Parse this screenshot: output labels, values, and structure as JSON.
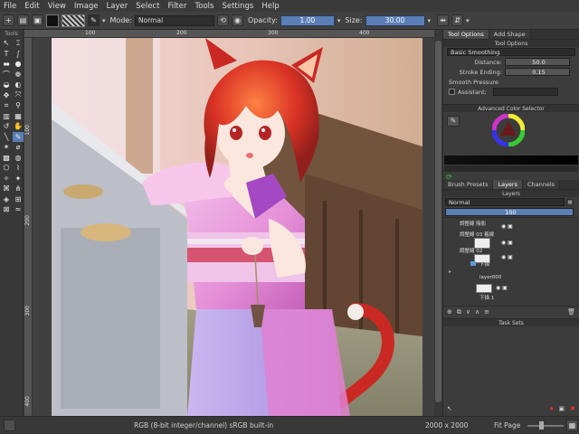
{
  "menu": [
    "File",
    "Edit",
    "View",
    "Image",
    "Layer",
    "Select",
    "Filter",
    "Tools",
    "Settings",
    "Help"
  ],
  "toolbar": {
    "mode_label": "Mode:",
    "mode_value": "Normal",
    "opacity_label": "Opacity:",
    "opacity_value": "1.00",
    "size_label": "Size:",
    "size_value": "30.00"
  },
  "toolbox_title": "Tools",
  "ruler": {
    "h_labels": [
      "100",
      "200",
      "300",
      "400"
    ],
    "v_labels": [
      "100",
      "200",
      "300",
      "400"
    ]
  },
  "dock": {
    "top_tabs": [
      "Tool Options",
      "Add Shape"
    ],
    "tool_options_title": "Tool Options",
    "smoothing": "Basic Smoothing",
    "distance_label": "Distance:",
    "distance_value": "50.0",
    "stroke_ending_label": "Stroke Ending:",
    "stroke_ending_value": "0.15",
    "smooth_pressure_label": "Smooth Pressure",
    "assistant_label": "Assistant:",
    "color_selector_title": "Advanced Color Selector",
    "mid_tabs": [
      "Brush Presets",
      "Layers",
      "Channels"
    ],
    "layers_title": "Layers",
    "blend_mode": "Normal",
    "opacity_value": "100",
    "layer_names": [
      "調整線 陰影",
      "調整線 03 着線",
      "調整線 02",
      "下描",
      "layer000",
      "下描 1"
    ],
    "task_sets_title": "Task Sets"
  },
  "status": {
    "color_model": "RGB (8-bit integer/channel)  sRGB built-in",
    "dimensions": "2000 x 2000",
    "zoom_mode": "Fit Page"
  },
  "colors": {
    "accent": "#5a7fb5",
    "hair": "#d8281a",
    "kimono": "#e48ad6",
    "skin": "#fbe6dc",
    "wall": "#6a4a34"
  }
}
